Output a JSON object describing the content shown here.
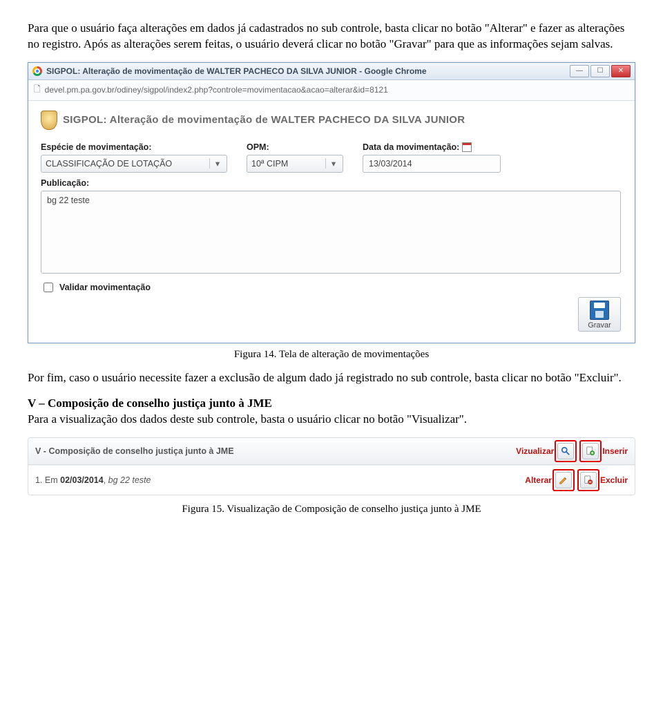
{
  "para1": "Para que o usuário faça alterações em dados já cadastrados no sub controle, basta clicar no botão \"Alterar\" e fazer as alterações no registro. Após as alterações serem feitas, o usuário deverá clicar no botão \"Gravar\" para que as informações sejam salvas.",
  "chrome": {
    "title": "SIGPOL: Alteração de movimentação de WALTER PACHECO DA SILVA JUNIOR - Google Chrome",
    "url": "devel.pm.pa.gov.br/odiney/sigpol/index2.php?controle=movimentacao&acao=alterar&id=8121",
    "min": "—",
    "max": "☐",
    "close": "✕"
  },
  "page": {
    "header": "SIGPOL: Alteração de movimentação de WALTER PACHECO DA SILVA JUNIOR",
    "labels": {
      "especie": "Espécie de movimentação:",
      "opm": "OPM:",
      "data": "Data da movimentação:",
      "pub": "Publicação:",
      "validar": "Validar movimentação"
    },
    "values": {
      "especie": "CLASSIFICAÇÃO DE LOTAÇÃO",
      "opm": "10ª CIPM",
      "data": "13/03/2014",
      "pub": "bg 22 teste"
    },
    "save": "Gravar"
  },
  "caption1": "Figura 14. Tela de alteração de movimentações",
  "para2": "Por fim, caso o usuário necessite fazer a exclusão de algum dado já registrado no sub controle, basta clicar no botão \"Excluir\".",
  "section5": {
    "title": "V – Composição de conselho justiça junto à JME",
    "text": "Para a visualização dos dados deste sub controle, basta o usuário clicar no botão \"Visualizar\"."
  },
  "subcontrol": {
    "title": "V - Composição de conselho justiça junto à JME",
    "actions": {
      "viz": "Vizualizar",
      "ins": "Inserir",
      "alt": "Alterar",
      "exc": "Excluir"
    },
    "row_prefix": "1. Em ",
    "row_date": "02/03/2014",
    "row_sep": ", ",
    "row_desc": "bg 22 teste"
  },
  "caption2": "Figura 15. Visualização de Composição de conselho justiça junto à JME"
}
